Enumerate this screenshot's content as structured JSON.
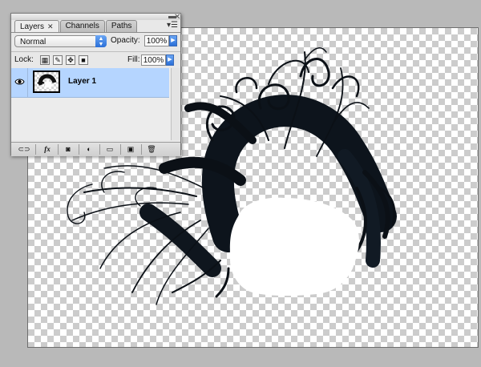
{
  "palette": {
    "tabs": [
      {
        "label": "Layers",
        "close": "✕"
      },
      {
        "label": "Channels"
      },
      {
        "label": "Paths"
      }
    ],
    "blend_mode": "Normal",
    "opacity_label": "Opacity:",
    "opacity_value": "100%",
    "lock_label": "Lock:",
    "fill_label": "Fill:",
    "fill_value": "100%",
    "layers": [
      {
        "name": "Layer 1",
        "visible": true,
        "selected": true
      }
    ],
    "bottom_icons": [
      "link-icon",
      "fx-icon",
      "mask-icon",
      "adjustment-icon",
      "group-folder-icon",
      "new-layer-icon",
      "trash-icon"
    ],
    "fx_label": "fx"
  },
  "colors": {
    "selection": "#b5d5ff",
    "accent_blue": "#2a6fd8",
    "hair": "#0b1016"
  }
}
